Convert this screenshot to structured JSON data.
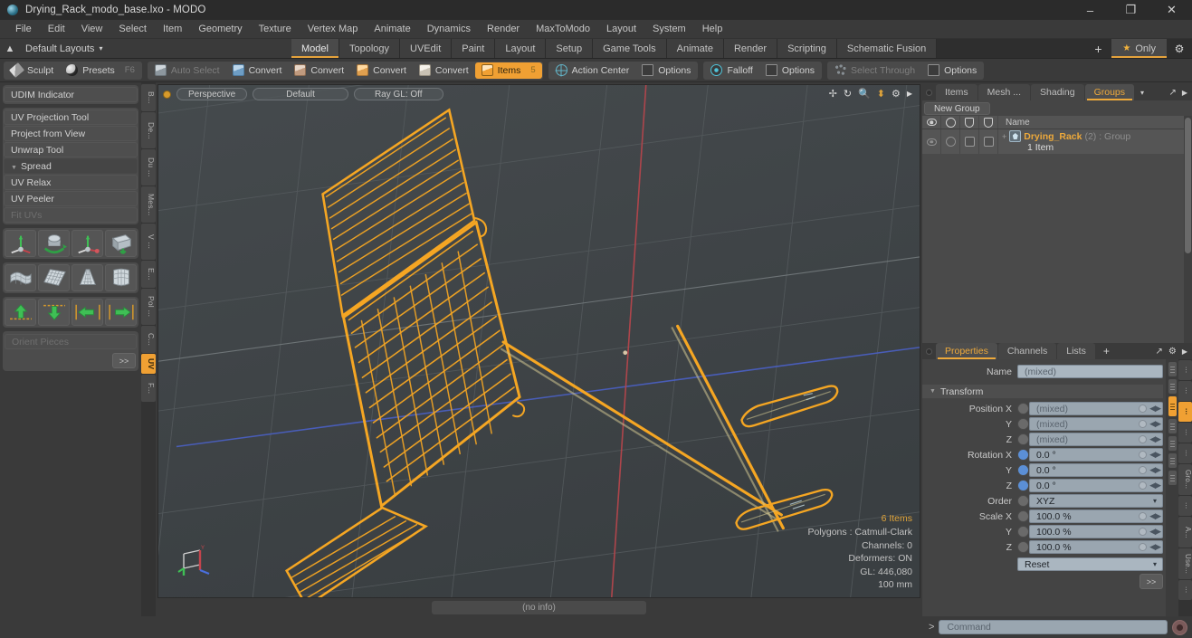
{
  "window": {
    "title": "Drying_Rack_modo_base.lxo - MODO",
    "app_icon": "modo-sphere-icon",
    "minimize": "–",
    "maximize": "❐",
    "close": "✕"
  },
  "menubar": {
    "items": [
      "File",
      "Edit",
      "View",
      "Select",
      "Item",
      "Geometry",
      "Texture",
      "Vertex Map",
      "Animate",
      "Dynamics",
      "Render",
      "MaxToModo",
      "Layout",
      "System",
      "Help"
    ]
  },
  "layoutbar": {
    "layout_label": "Default Layouts",
    "caret": "▾",
    "tabs": [
      {
        "label": "Model",
        "active": true
      },
      {
        "label": "Topology",
        "active": false
      },
      {
        "label": "UVEdit",
        "active": false
      },
      {
        "label": "Paint",
        "active": false
      },
      {
        "label": "Layout",
        "active": false
      },
      {
        "label": "Setup",
        "active": false
      },
      {
        "label": "Game Tools",
        "active": false
      },
      {
        "label": "Animate",
        "active": false
      },
      {
        "label": "Render",
        "active": false
      },
      {
        "label": "Scripting",
        "active": false
      },
      {
        "label": "Schematic Fusion",
        "active": false
      }
    ],
    "add_tab": "+",
    "only_label": "Only",
    "only_star": "★",
    "gear": "⚙"
  },
  "toolbar": {
    "groups": [
      {
        "buttons": [
          {
            "label": "Sculpt",
            "icon": "brush-icon",
            "state": "normal"
          },
          {
            "label": "Presets",
            "icon": "sphere-icon",
            "state": "normal",
            "kbd": "F6"
          }
        ]
      },
      {
        "buttons": [
          {
            "label": "Auto Select",
            "icon": "cube-gray-icon",
            "state": "disabled"
          },
          {
            "label": "Convert",
            "icon": "cube-blue-icon",
            "state": "normal"
          },
          {
            "label": "Convert",
            "icon": "cube-pink-icon",
            "state": "normal"
          },
          {
            "label": "Convert",
            "icon": "cube-orange-icon",
            "state": "normal"
          },
          {
            "label": "Convert",
            "icon": "cube-white-icon",
            "state": "normal"
          },
          {
            "label": "Items",
            "icon": "cube-selected-icon",
            "state": "active",
            "kbd": "5"
          }
        ]
      },
      {
        "buttons": [
          {
            "label": "Action Center",
            "icon": "crosshair-icon",
            "state": "normal"
          },
          {
            "label": "Options",
            "icon": "checkbox-icon",
            "state": "normal"
          }
        ]
      },
      {
        "buttons": [
          {
            "label": "Falloff",
            "icon": "falloff-icon",
            "state": "normal"
          },
          {
            "label": "Options",
            "icon": "checkbox-icon",
            "state": "normal"
          }
        ]
      },
      {
        "buttons": [
          {
            "label": "Select Through",
            "icon": "dots-icon",
            "state": "disabled"
          },
          {
            "label": "Options",
            "icon": "checkbox-icon",
            "state": "normal"
          }
        ]
      }
    ]
  },
  "left_panel": {
    "groups": [
      {
        "rows": [
          {
            "label": "UDIM Indicator",
            "state": "normal"
          }
        ]
      },
      {
        "rows": [
          {
            "label": "UV Projection Tool",
            "state": "normal"
          },
          {
            "label": "Project from View",
            "state": "normal"
          },
          {
            "label": "Unwrap Tool",
            "state": "normal"
          },
          {
            "label": "Spread",
            "state": "header"
          },
          {
            "label": "UV Relax",
            "state": "normal"
          },
          {
            "label": "UV Peeler",
            "state": "normal"
          },
          {
            "label": "Fit UVs",
            "state": "disabled"
          }
        ]
      }
    ],
    "icon_rows": [
      [
        "uv-projection-axis-icon",
        "uv-rotate-icon",
        "uv-move-axis-icon",
        "uv-unwrap-icon"
      ],
      [
        "uv-relax-icon",
        "uv-grid-flat-icon",
        "uv-cone-icon",
        "uv-peeler-icon"
      ],
      [
        "move-up-icon",
        "move-down-icon",
        "move-left-icon",
        "move-right-icon"
      ]
    ],
    "orient_label": "Orient Pieces",
    "orient_state": "disabled",
    "more_button": ">>",
    "vtabs": [
      {
        "label": "B...",
        "active": false
      },
      {
        "label": "De...",
        "active": false
      },
      {
        "label": "Du ...",
        "active": false
      },
      {
        "label": "Mes...",
        "active": false
      },
      {
        "label": "V ...",
        "active": false
      },
      {
        "label": "E...",
        "active": false
      },
      {
        "label": "Pol ...",
        "active": false
      },
      {
        "label": "C...",
        "active": false
      },
      {
        "label": "UV",
        "active": true
      },
      {
        "label": "F...",
        "active": false
      }
    ]
  },
  "viewport": {
    "dot": "viewport-menu-dot",
    "buttons": [
      "Perspective",
      "Default",
      "Ray GL: Off"
    ],
    "nav_icons": [
      "pan-icon",
      "rotate-icon",
      "zoom-icon",
      "fit-icon",
      "settings-icon",
      "expand-icon"
    ],
    "info": {
      "items": "6 Items",
      "polygons": "Polygons : Catmull-Clark",
      "channels": "Channels: 0",
      "deformers": "Deformers: ON",
      "gl": "GL: 446,080",
      "scale": "100 mm"
    },
    "gizmo": "axis-gizmo",
    "footer": "(no info)"
  },
  "right_panel": {
    "top_tabs": [
      {
        "label": "Items",
        "active": false
      },
      {
        "label": "Mesh ...",
        "active": false
      },
      {
        "label": "Shading",
        "active": false
      },
      {
        "label": "Groups",
        "active": true
      }
    ],
    "top_tab_caret": "▾",
    "top_tab_icons": [
      "expand-icon",
      "arrow-right-icon"
    ],
    "new_group_button": "New Group",
    "tree": {
      "column_icons": [
        "eye-icon",
        "moon-icon",
        "shield-icon",
        "shield-alt-icon"
      ],
      "name_header": "Name",
      "rows": [
        {
          "expander": "+",
          "icon": "group-icon",
          "name": "Drying_Rack",
          "meta": "(2) : Group",
          "sub": "1 Item"
        }
      ]
    },
    "prop_tabs": [
      {
        "label": "Properties",
        "active": true
      },
      {
        "label": "Channels",
        "active": false
      },
      {
        "label": "Lists",
        "active": false
      }
    ],
    "prop_tab_add": "+",
    "prop_tab_icons": [
      "expand-icon",
      "gear-icon",
      "arrow-right-icon"
    ],
    "properties": {
      "name_label": "Name",
      "name_value": "(mixed)",
      "transform_section": "Transform",
      "rows": [
        {
          "label": "Position X",
          "value": "(mixed)",
          "radio": "gray",
          "kind": "num"
        },
        {
          "label": "Y",
          "value": "(mixed)",
          "radio": "gray",
          "kind": "num"
        },
        {
          "label": "Z",
          "value": "(mixed)",
          "radio": "gray",
          "kind": "num"
        },
        {
          "label": "Rotation X",
          "value": "0.0 °",
          "radio": "blue",
          "kind": "num"
        },
        {
          "label": "Y",
          "value": "0.0 °",
          "radio": "blue",
          "kind": "num"
        },
        {
          "label": "Z",
          "value": "0.0 °",
          "radio": "blue",
          "kind": "num"
        },
        {
          "label": "Order",
          "value": "XYZ",
          "radio": "gray",
          "kind": "drop"
        },
        {
          "label": "Scale X",
          "value": "100.0 %",
          "radio": "gray",
          "kind": "num"
        },
        {
          "label": "Y",
          "value": "100.0 %",
          "radio": "gray",
          "kind": "num"
        },
        {
          "label": "Z",
          "value": "100.0 %",
          "radio": "gray",
          "kind": "num"
        }
      ],
      "reset_label": "Reset",
      "reset_caret": "▾",
      "more_button": ">>"
    },
    "vtabs": [
      {
        "label": "...",
        "active": false
      },
      {
        "label": "...",
        "active": false
      },
      {
        "label": "...",
        "active": true
      },
      {
        "label": "...",
        "active": false
      },
      {
        "label": "...",
        "active": false
      },
      {
        "label": "Gro...",
        "active": false
      },
      {
        "label": "...",
        "active": false
      },
      {
        "label": "A...",
        "active": false
      },
      {
        "label": "Use...",
        "active": false
      },
      {
        "label": "...",
        "active": false
      }
    ]
  },
  "command_bar": {
    "prompt": ">",
    "placeholder": "Command",
    "record_button": "record-icon"
  },
  "colors": {
    "accent": "#f0a033",
    "selection": "#eda93b",
    "viewport_bg": "#3f4447",
    "mesh": "#f5a623",
    "axis_x": "#b4464c",
    "axis_z": "#4a5fbf",
    "panel_bg": "#3a3a3a"
  }
}
